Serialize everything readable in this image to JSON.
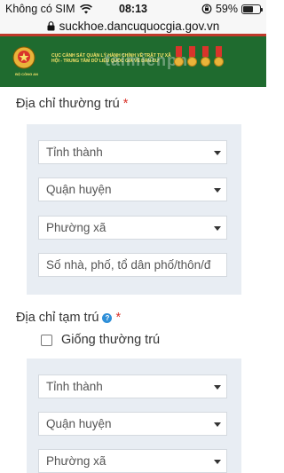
{
  "status_bar": {
    "carrier": "Không có SIM",
    "time": "08:13",
    "battery_percent": "59%",
    "battery_level": 0.59
  },
  "url_bar": {
    "url": "suckhoe.dancuquocgia.gov.vn"
  },
  "banner": {
    "title": "CỤC CẢNH SÁT QUẢN LÝ HÀNH CHÍNH VỀ TRẬT TỰ XÃ HỘI - TRUNG TÂM DỮ LIỆU QUỐC GIA VỀ DÂN CƯ",
    "emblem_label": "BỘ CÔNG AN",
    "watermark": "taimienphi"
  },
  "permanent_address": {
    "label": "Địa chỉ thường trú",
    "required_mark": "*",
    "province": {
      "placeholder": "Tỉnh thành"
    },
    "district": {
      "placeholder": "Quận huyện"
    },
    "ward": {
      "placeholder": "Phường xã"
    },
    "street": {
      "placeholder": "Số nhà, phố, tổ dân phố/thôn/đ"
    }
  },
  "temporary_address": {
    "label": "Địa chỉ tạm trú",
    "help_icon": "?",
    "required_mark": "*",
    "same_as_permanent_label": "Giống thường trú",
    "same_as_permanent_checked": false,
    "province": {
      "placeholder": "Tỉnh thành"
    },
    "district": {
      "placeholder": "Quận huyện"
    },
    "ward": {
      "placeholder": "Phường xã"
    }
  },
  "icons": {
    "wifi": "wifi-icon",
    "lock": "lock-icon",
    "rotation_lock": "rotation-lock-icon",
    "dropdown": "chevron-down-icon",
    "help": "help-icon"
  },
  "colors": {
    "banner_green": "#1f6b2f",
    "banner_text": "#f7e36a",
    "required_red": "#d9342b",
    "panel_bg": "#e8edf3",
    "help_blue": "#2f8fd8"
  }
}
